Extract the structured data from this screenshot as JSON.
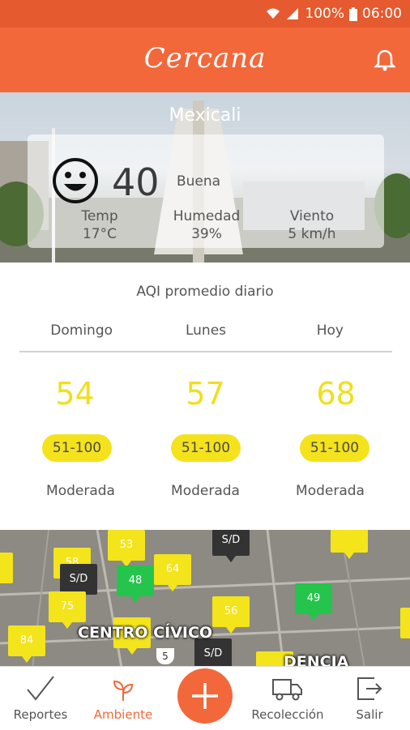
{
  "status_bar": {
    "battery": "100%",
    "time": "06:00"
  },
  "app": {
    "title": "Cercana"
  },
  "hero": {
    "city": "Mexicali",
    "aqi": "40",
    "aqi_label": "Buena",
    "temp_label": "Temp",
    "temp_value": "17°C",
    "humidity_label": "Humedad",
    "humidity_value": "39%",
    "wind_label": "Viento",
    "wind_value": "5 km/h"
  },
  "daily": {
    "title": "AQI promedio diario",
    "days": [
      {
        "name": "Domingo",
        "value": "54",
        "range": "51-100",
        "category": "Moderada"
      },
      {
        "name": "Lunes",
        "value": "57",
        "range": "51-100",
        "category": "Moderada"
      },
      {
        "name": "Hoy",
        "value": "68",
        "range": "51-100",
        "category": "Moderada"
      }
    ]
  },
  "map": {
    "labels": [
      "CENTRO CÍVICO",
      "DENCIA"
    ],
    "markers": [
      "53",
      "S/D",
      "58",
      "S/D",
      "48",
      "64",
      "75",
      "49",
      "56",
      "84",
      "89",
      "S/D",
      "5"
    ]
  },
  "bottom_nav": {
    "reportes": "Reportes",
    "ambiente": "Ambiente",
    "recoleccion": "Recolección",
    "salir": "Salir"
  },
  "colors": {
    "primary": "#f2683b",
    "moderate": "#f4e21c",
    "good": "#25c44d"
  }
}
